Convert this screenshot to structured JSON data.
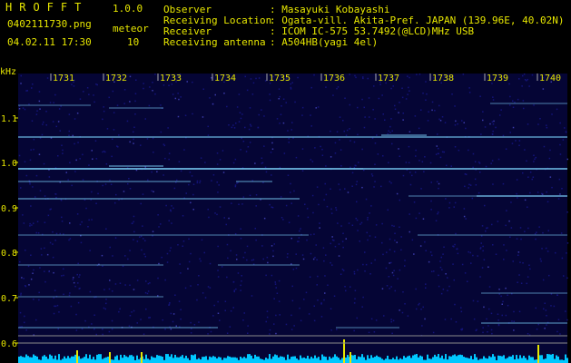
{
  "header": {
    "app_title": "HROFFT",
    "app_version": "1.0.0",
    "filename": "0402111730.png",
    "timestamp": "04.02.11 17:30",
    "mode_label": "meteor",
    "count_value": "10"
  },
  "meta": [
    {
      "key": "Observer",
      "value": ": Masayuki Kobayashi"
    },
    {
      "key": "Receiving Location",
      "value": ": Ogata-vill. Akita-Pref. JAPAN (139.96E, 40.02N)"
    },
    {
      "key": "Receiver",
      "value": ": ICOM IC-575 53.7492(@LCD)MHz USB"
    },
    {
      "key": "Receiving antenna",
      "value": ": A504HB(yagi 4el)"
    }
  ],
  "axes": {
    "y_unit": "kHz",
    "y_ticks": [
      "1.1",
      "1.0",
      "0.9",
      "0.8",
      "0.7",
      "0.6"
    ],
    "time_ticks": [
      "1731",
      "1732",
      "1733",
      "1734",
      "1735",
      "1736",
      "1737",
      "1738",
      "1739",
      "1740"
    ]
  },
  "colors": {
    "text": "#e6e600",
    "background": "#000000",
    "noise": "#0a0a5a",
    "signal": "#7fd7ff",
    "activity": "#00c8ff"
  }
}
